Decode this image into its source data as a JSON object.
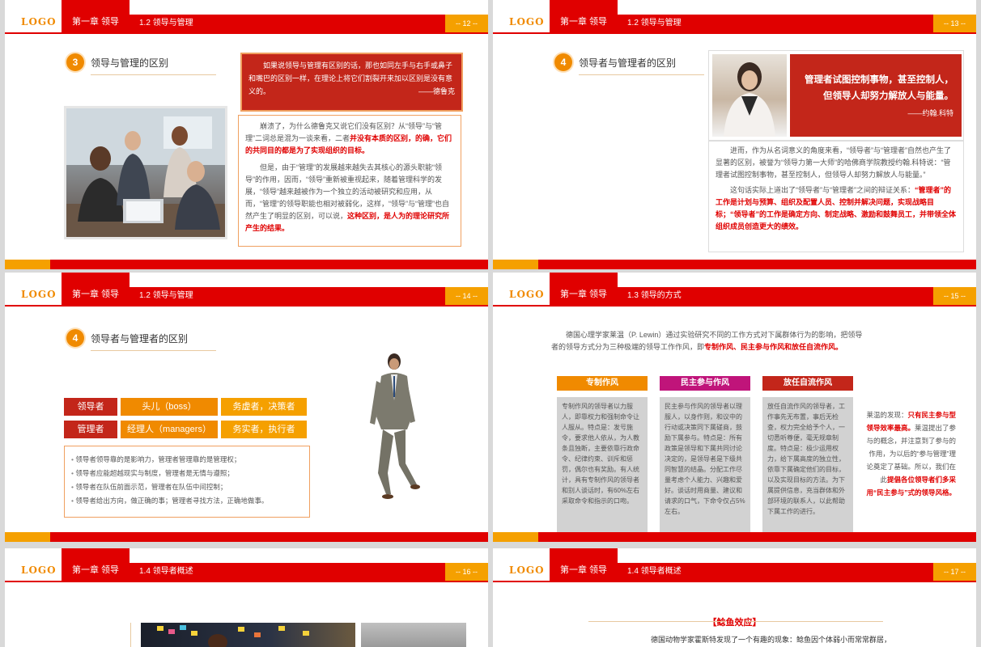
{
  "colors": {
    "red": "#e00000",
    "dark_red": "#c3261a",
    "orange": "#f08a00",
    "amber": "#f5a000",
    "magenta": "#c0147a"
  },
  "common": {
    "logo": "LOGO",
    "chapter": "第一章 领导"
  },
  "s12": {
    "section": "1.2 领导与管理",
    "page": "-- 12 --",
    "num": "3",
    "title": "领导与管理的区别",
    "quote": "如果说领导与管理有区别的话，那也如同左手与右手或鼻子和嘴巴的区别一样，在理论上将它们割裂开来加以区别是没有意义的。",
    "quote_author": "——德鲁克",
    "p1_a": "崩溃了，为什么德鲁克又说它们没有区别？从“领导”与“管理”二词总是混为一谈来看，二者",
    "p1_b": "并没有本质的区别，的确，它们的共同目的都是为了实现组织的目标。",
    "p2_a": "但是，由于“管理”的发展越来越失去其核心的源头职能“领导”的作用，因而，“领导”重新被重视起来，随着管理科学的发展，“领导”越来越被作为一个独立的活动被研究和应用，从而，“管理”的领导职能也相对被弱化，这样，“领导”与“管理”也自然产生了明显的区别，可以说，",
    "p2_b": "这种区别，是人为的理论研究所产生的结果。"
  },
  "s13": {
    "section": "1.2 领导与管理",
    "page": "-- 13 --",
    "num": "4",
    "title": "领导者与管理者的区别",
    "quote": "管理者试图控制事物，甚至控制人，但领导人却努力解放人与能量。",
    "quote_author": "——约翰.科特",
    "p1": "进而，作为从名词意义的角度来看，“领导者”与“管理者”自然也产生了显著的区别，被誉为“领导力第一大师”的哈佛商学院教授约翰.科特说：“管理者试图控制事物，甚至控制人，但领导人却努力解放人与能量。”",
    "p2_a": "这句话实际上道出了“领导者”与“管理者”之间的辩证关系：",
    "p2_b": "“管理者”的工作是计划与预算、组织及配置人员、控制并解决问题，实现战略目标；“领导者”的工作是确定方向、制定战略、激励和鼓舞员工，并带领全体组织成员创造更大的绩效。"
  },
  "s14": {
    "section": "1.2 领导与管理",
    "page": "-- 14 --",
    "num": "4",
    "title": "领导者与管理者的区别",
    "rows": [
      {
        "role": "领导者",
        "alias": "头儿（boss）",
        "trait": "务虚者，决策者"
      },
      {
        "role": "管理者",
        "alias": "经理人（managers）",
        "trait": "务实者，执行者"
      }
    ],
    "bullets": [
      "领导者领导靠的是影响力，管理者管理靠的是管理权；",
      "领导者应能超越现实与制度，管理者是无情与遵照；",
      "领导者在队伍前面示范，管理者在队伍中间控制；",
      "领导者给出方向，做正确的事；管理者寻找方法，正确地做事。"
    ]
  },
  "s15": {
    "section": "1.3 领导的方式",
    "page": "-- 15 --",
    "intro_a": "德国心理学家莱温（P. Lewin）通过实验研究不同的工作方式对下属群体行为的影响，把领导者的领导方式分为三种极端的领导工作作风，即",
    "intro_b": "专制作风、民主参与作风和放任自流作风。",
    "columns": [
      {
        "title": "专制作风",
        "color": "#f08a00",
        "body": "专制作风的领导者以力服人，即靠权力和强制命令让人服从。特点是：发号施令，要求他人依从，为人教条且独断，主要依靠行政命令、纪律约束、训斥和惩罚，偶尔也有奖励。有人统计，具有专制作风的领导者和别人谈话时，有60%左右采取命令和指示的口吻。"
      },
      {
        "title": "民主参与作风",
        "color": "#c0147a",
        "body": "民主参与作风的领导者以理服人，以身作则，和议中的行动或决策同下属磋商，鼓励下属参与。特点是：所有政策是领导和下属共同讨论决定的，是领导者是下级共同智慧的结晶。分配工作尽量考虑个人能力、兴趣和爱好。谈话时用商量、建议和请求的口气，下命令仅占5%左右。"
      },
      {
        "title": "放任自流作风",
        "color": "#c3261a",
        "body": "放任自流作风的领导者，工作事先无布置，事后无检查，权力完全给予个人，一切悉听尊便，毫无规章制度。特点是：极少运用权力，给下属高度的独立性，依靠下属确定他们的目标，以及实现目标的方法。为下属提供信息，充当群体和外部环境的联系人，以此帮助下属工作的进行。"
      }
    ],
    "side_a": "莱温的发现：",
    "side_b": "只有民主参与型领导效率最高。",
    "side_c": "莱温提出了参与的概念，并注意到了参与的作用，为以后的“参与管理”理论奠定了基础。所以，我们在此",
    "side_d": "提倡各位领导者们多采用“民主参与”式的领导风格。"
  },
  "s16": {
    "section": "1.4 领导者概述",
    "page": "-- 16 --"
  },
  "s17": {
    "section": "1.4 领导者概述",
    "page": "-- 17 --",
    "heading": "【鲶鱼效应】",
    "intro": "德国动物学家霍斯特发现了一个有趣的现象：鲶鱼因个体弱小而常常群居，"
  }
}
